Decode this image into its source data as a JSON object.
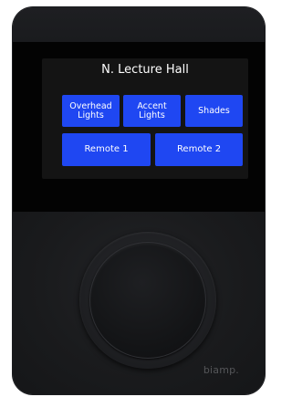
{
  "screen": {
    "title": "N. Lecture Hall",
    "buttons": [
      {
        "label": "Overhead\nLights"
      },
      {
        "label": "Accent\nLights"
      },
      {
        "label": "Shades"
      },
      {
        "label": "Remote 1"
      },
      {
        "label": "Remote 2"
      }
    ]
  },
  "device": {
    "brand": "biamp."
  },
  "colors": {
    "button_blue": "#1f47f2",
    "screen_bg": "#141414",
    "device_body": "#1a1b1e"
  }
}
